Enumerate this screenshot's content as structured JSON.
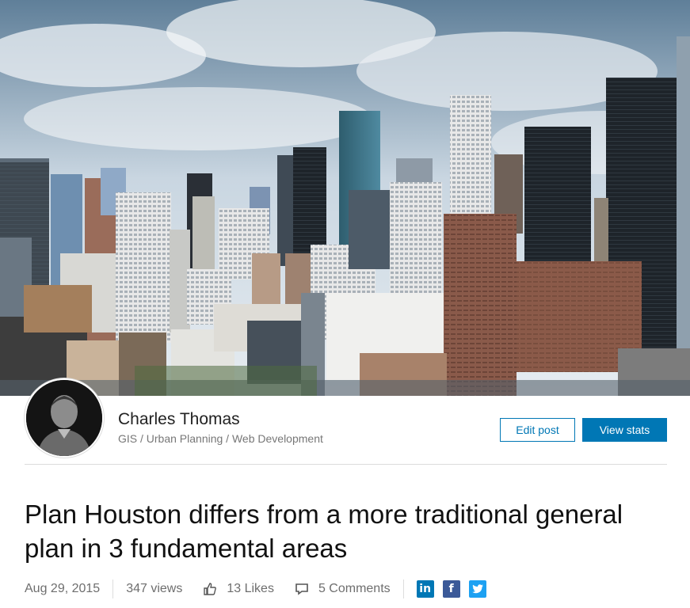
{
  "author": {
    "name": "Charles Thomas",
    "headline": "GIS / Urban Planning / Web Development"
  },
  "actions": {
    "edit_label": "Edit post",
    "stats_label": "View stats"
  },
  "post": {
    "title": "Plan Houston differs from a more traditional general plan in 3 fundamental areas",
    "date": "Aug 29, 2015",
    "views": "347 views",
    "likes": "13 Likes",
    "comments": "5 Comments"
  },
  "icons": {
    "like": "thumbs-up-icon",
    "comment": "comment-icon",
    "share": [
      "linkedin-icon",
      "facebook-icon",
      "twitter-icon"
    ]
  },
  "colors": {
    "accent": "#0077b5",
    "linkedin": "#0077b5",
    "facebook": "#3b5998",
    "twitter": "#1da1f2"
  }
}
